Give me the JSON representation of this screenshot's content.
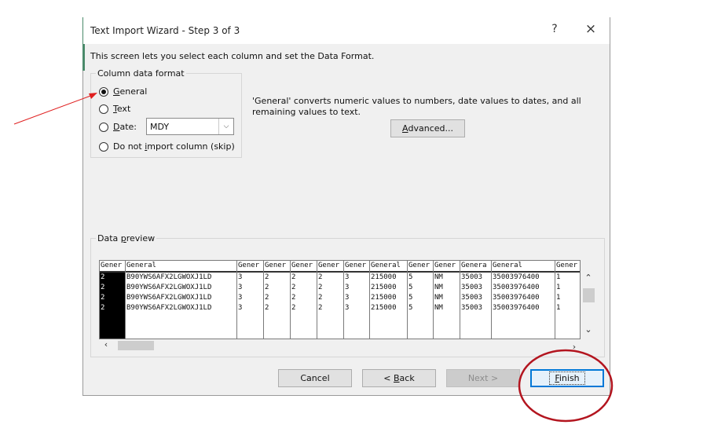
{
  "window": {
    "title": "Text Import Wizard - Step 3 of 3",
    "help": "?",
    "close": "×"
  },
  "intro": "This screen lets you select each column and set the Data Format.",
  "column_format": {
    "title": "Column data format",
    "general_label": "eneral",
    "general_key": "G",
    "text_label": "ext",
    "text_key": "T",
    "date_label": "ate:",
    "date_key": "D",
    "skip_label_a": "Do not ",
    "skip_key": "i",
    "skip_label_b": "mport column (skip)",
    "date_value": "MDY",
    "selected": "General"
  },
  "description": "'General' converts numeric values to numbers, date values to dates, and all remaining values to text.",
  "advanced_button": {
    "key": "A",
    "rest": "dvanced..."
  },
  "preview": {
    "title_a": "Data ",
    "title_key": "p",
    "title_b": "review",
    "columns": [
      {
        "header": "Gener",
        "cells": [
          "2",
          "2",
          "2",
          "2"
        ]
      },
      {
        "header": "General",
        "cells": [
          "B90YWS6AFX2LGWOXJ1LD",
          "B90YWS6AFX2LGWOXJ1LD",
          "B90YWS6AFX2LGWOXJ1LD",
          "B90YWS6AFX2LGWOXJ1LD"
        ]
      },
      {
        "header": "Gener",
        "cells": [
          "3",
          "3",
          "3",
          "3"
        ]
      },
      {
        "header": "Gener",
        "cells": [
          "2",
          "2",
          "2",
          "2"
        ]
      },
      {
        "header": "Gener",
        "cells": [
          "2",
          "2",
          "2",
          "2"
        ]
      },
      {
        "header": "Gener",
        "cells": [
          "2",
          "2",
          "2",
          "2"
        ]
      },
      {
        "header": "Gener",
        "cells": [
          "3",
          "3",
          "3",
          "3"
        ]
      },
      {
        "header": "General",
        "cells": [
          "215000",
          "215000",
          "215000",
          "215000"
        ]
      },
      {
        "header": "Gener",
        "cells": [
          "5",
          "5",
          "5",
          "5"
        ]
      },
      {
        "header": "Gener",
        "cells": [
          "NM",
          "NM",
          "NM",
          "NM"
        ]
      },
      {
        "header": "Genera",
        "cells": [
          "35003",
          "35003",
          "35003",
          "35003"
        ]
      },
      {
        "header": "General",
        "cells": [
          "35003976400",
          "35003976400",
          "35003976400",
          "35003976400"
        ]
      },
      {
        "header": "Gener",
        "cells": [
          "1",
          "1",
          "1",
          "1"
        ]
      }
    ]
  },
  "buttons": {
    "cancel": "Cancel",
    "back_prefix": "< ",
    "back_key": "B",
    "back_rest": "ack",
    "next": "Next >",
    "finish_key": "F",
    "finish_rest": "inish"
  },
  "annotation": {
    "arrow_color": "#e02020",
    "circle_color": "#b3151f"
  }
}
